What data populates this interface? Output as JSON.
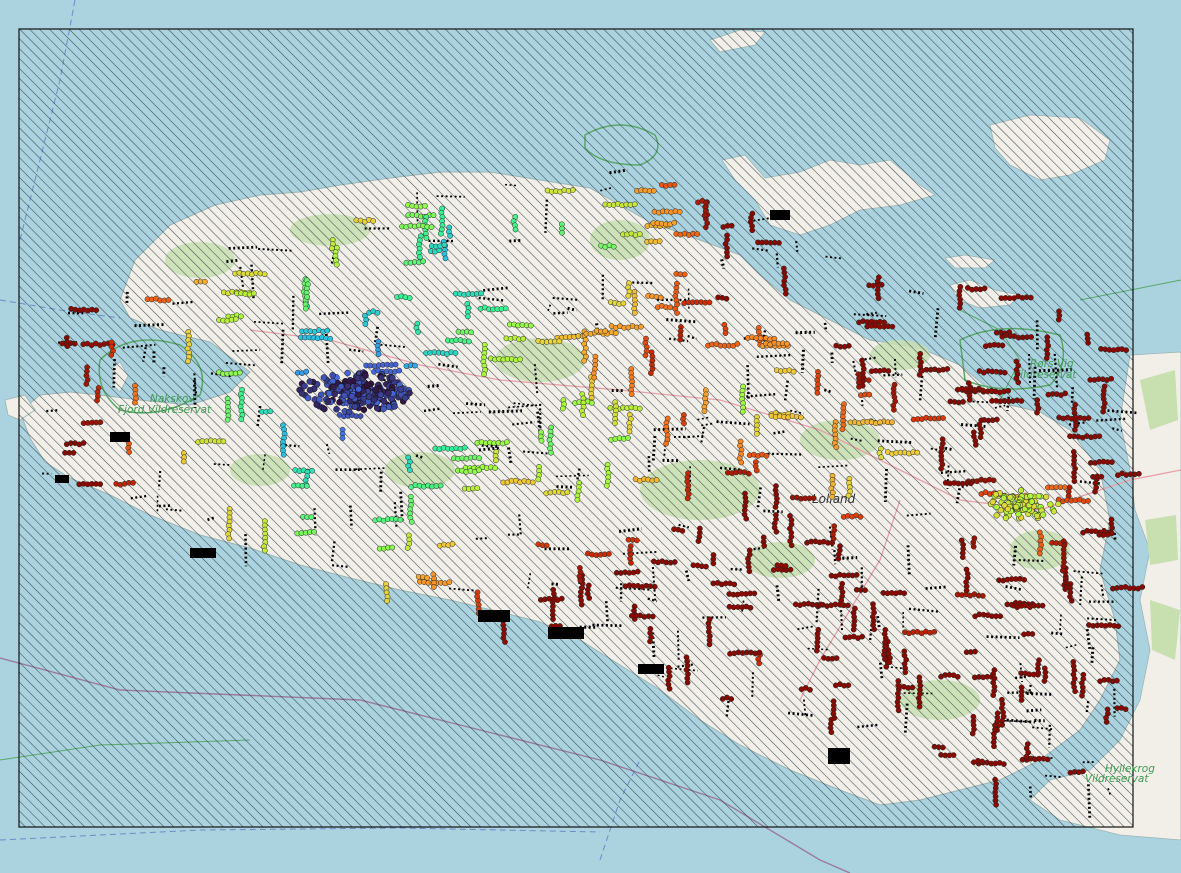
{
  "map": {
    "colors": {
      "water": "#aad3df",
      "land": "#f2efe9",
      "land_highlight": "#f5f3ea",
      "forest": "#c8dfb0",
      "hatch_line": "#2f3b42",
      "hatch_bg_land": "#eeeedc",
      "frame": "#111111",
      "protected_area": "#5aa86a",
      "boundary": "#9b7aa0",
      "road": "#e8a0a8",
      "cable": "#6a8cc8"
    },
    "labels": {
      "nakskov": [
        "Nakskov",
        "Fjord Vildreservat"
      ],
      "haars": [
        "Rørs Vig",
        "Vildreservat"
      ],
      "lolland": "Lolland",
      "hyllekrog": [
        "Hyllekrog",
        "Vildreservat"
      ]
    },
    "layers": [
      {
        "name": "study-area-hatch",
        "pattern": "diagonal-lines"
      },
      {
        "name": "points-colored",
        "colormap": "turbo-reversed"
      },
      {
        "name": "points-black",
        "color": "#000000"
      }
    ]
  }
}
